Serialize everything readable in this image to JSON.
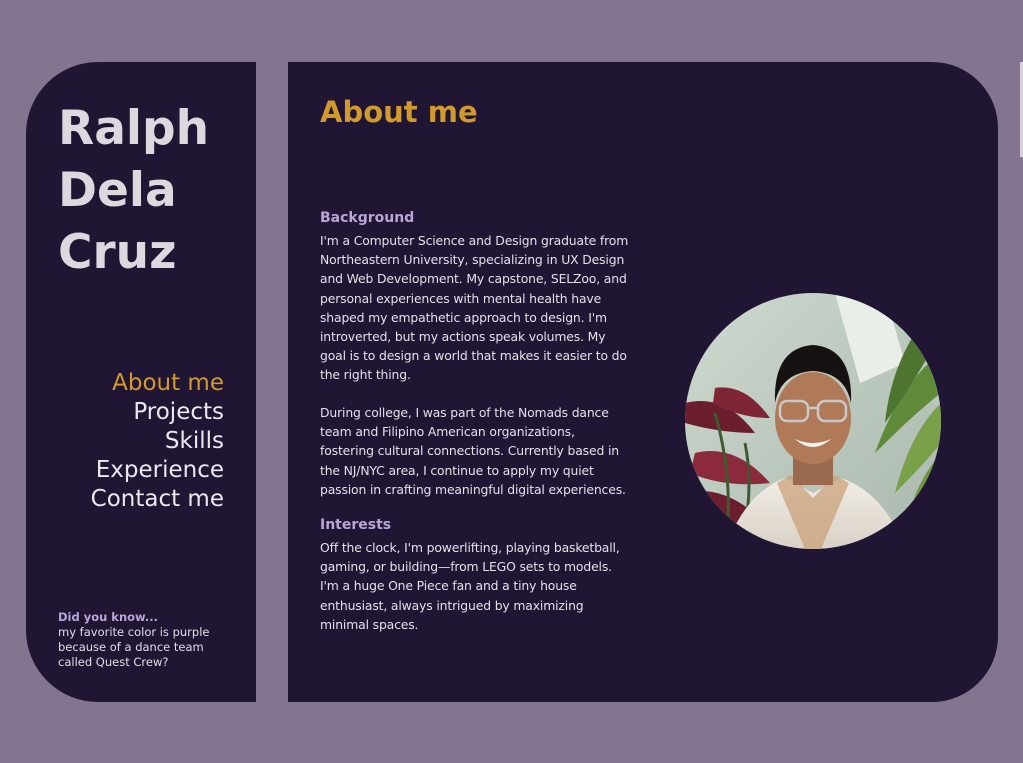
{
  "sidebar": {
    "name_lines": [
      "Ralph",
      "Dela",
      "Cruz"
    ],
    "nav": [
      {
        "label": "About me",
        "active": true
      },
      {
        "label": "Projects",
        "active": false
      },
      {
        "label": "Skills",
        "active": false
      },
      {
        "label": "Experience",
        "active": false
      },
      {
        "label": "Contact me",
        "active": false
      }
    ],
    "fact": {
      "title": "Did you know...",
      "body": "my favorite color is purple because of a dance team called Quest Crew?"
    }
  },
  "main": {
    "title": "About me",
    "background": {
      "heading": "Background",
      "paragraphs": [
        "I'm a Computer Science and Design graduate from Northeastern University, specializing in UX Design and Web Development. My capstone, SELZoo, and personal experiences with mental health have shaped my empathetic approach to design. I'm introverted, but my actions speak volumes. My goal is to design a world that makes it easier to do the right thing.",
        "During college, I was part of the Nomads dance team and Filipino American organizations, fostering cultural connections. Currently based in the NJ/NYC area, I continue to apply my quiet passion in crafting meaningful digital experiences."
      ]
    },
    "interests": {
      "heading": "Interests",
      "paragraph": "Off the clock, I'm powerlifting, playing basketball, gaming, or building—from LEGO sets to models. I'm a huge One Piece fan and a tiny house enthusiast, always intrigued by maximizing minimal spaces."
    }
  },
  "colors": {
    "page_background": "#83758f",
    "panel_background": "#201532",
    "accent": "#d09a2c",
    "heading_purple": "#b9a6d8",
    "text": "#e5e1ea"
  }
}
